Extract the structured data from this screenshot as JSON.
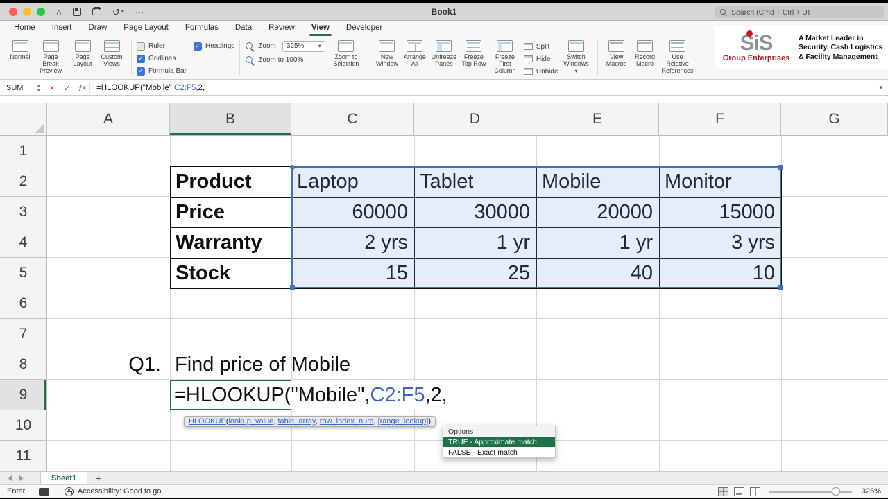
{
  "titlebar": {
    "title": "Book1",
    "search_placeholder": "Search (Cmd + Ctrl + U)"
  },
  "icons": {
    "home": "⌂",
    "undo": "↺",
    "more": "⋯",
    "chevron_down": "▾",
    "cancel": "×",
    "enter": "✓",
    "fx": "ƒx"
  },
  "ribbon_tabs": [
    "Home",
    "Insert",
    "Draw",
    "Page Layout",
    "Formulas",
    "Data",
    "Review",
    "View",
    "Developer"
  ],
  "active_tab": "View",
  "ribbon": {
    "views": [
      "Normal",
      "Page Break Preview",
      "Page Layout",
      "Custom Views"
    ],
    "show": [
      "Ruler",
      "Gridlines",
      "Formula Bar",
      "Headings"
    ],
    "zoom_label": "Zoom",
    "zoom_value": "325%",
    "zoom_100": "Zoom to 100%",
    "zoom_selection": "Zoom to Selection",
    "window": [
      "New Window",
      "Arrange All",
      "Unfreeze Panes",
      "Freeze Top Row",
      "Freeze First Column",
      "Split",
      "Hide",
      "Unhide",
      "Switch Windows"
    ],
    "macros": [
      "View Macros",
      "Record Macro",
      "Use Relative References"
    ]
  },
  "logo": {
    "brand": "SiS",
    "brand_sub": "Group Enterprises",
    "tagline_1": "A Market Leader in",
    "tagline_2": "Security, Cash Logistics",
    "tagline_3": "& Facility Management"
  },
  "formula_bar": {
    "name_box": "SUM",
    "formula_prefix": "=HLOOKUP(\"Mobile\",",
    "formula_range": "C2:F5",
    "formula_suffix": ",2,"
  },
  "grid": {
    "columns": [
      "A",
      "B",
      "C",
      "D",
      "E",
      "F",
      "G"
    ],
    "rows": [
      "1",
      "2",
      "3",
      "4",
      "5",
      "6",
      "7",
      "8",
      "9",
      "10",
      "11"
    ],
    "selected_column": "B",
    "selected_row": "9"
  },
  "sheet": {
    "table": {
      "rows": [
        {
          "label": "Product",
          "values": [
            "Laptop",
            "Tablet",
            "Mobile",
            "Monitor"
          ]
        },
        {
          "label": "Price",
          "values": [
            "60000",
            "30000",
            "20000",
            "15000"
          ]
        },
        {
          "label": "Warranty",
          "values": [
            "2 yrs",
            "1 yr",
            "1 yr",
            "3 yrs"
          ]
        },
        {
          "label": "Stock",
          "values": [
            "15",
            "25",
            "40",
            "10"
          ]
        }
      ]
    },
    "q1_label": "Q1.",
    "q1_text": "Find price of Mobile",
    "formula_prefix": "=HLOOKUP(\"Mobile\",",
    "formula_range": "C2:F5",
    "formula_suffix": ",2,"
  },
  "tooltip": {
    "fn": "HLOOKUP",
    "open": "(",
    "args": [
      "lookup_value",
      "table_array",
      "row_index_num",
      "[range_lookup]"
    ],
    "sep": ", ",
    "close": ")"
  },
  "autocomplete": {
    "header": "Options",
    "options": [
      {
        "label": "TRUE - Approximate match",
        "selected": true
      },
      {
        "label": "FALSE - Exact match",
        "selected": false
      }
    ]
  },
  "sheet_tabs": {
    "active": "Sheet1",
    "add_label": "+"
  },
  "status_bar": {
    "mode": "Enter",
    "accessibility": "Accessibility: Good to go",
    "zoom": "325%"
  }
}
